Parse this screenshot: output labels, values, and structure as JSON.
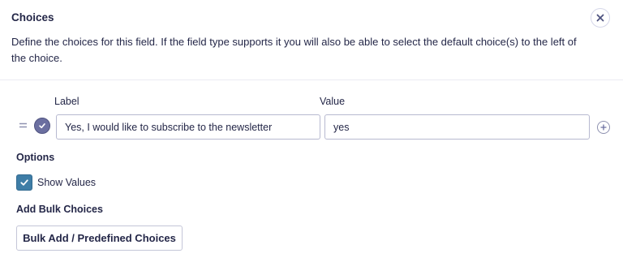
{
  "dialog": {
    "title": "Choices",
    "description": "Define the choices for this field. If the field type supports it you will also be able to select the default choice(s) to the left of the choice.",
    "close_icon": "close-icon"
  },
  "choices": {
    "label_header": "Label",
    "value_header": "Value",
    "rows": [
      {
        "label": "Yes, I would like to subscribe to the newsletter",
        "value": "yes",
        "is_default": true
      }
    ],
    "drag_icon": "drag-handle-icon",
    "add_icon": "plus-circle-icon"
  },
  "options": {
    "heading": "Options",
    "show_values_label": "Show Values",
    "show_values_checked": true
  },
  "bulk": {
    "heading": "Add Bulk Choices",
    "button_label": "Bulk Add / Predefined Choices"
  },
  "colors": {
    "text": "#242748",
    "checkbox_accent": "#3e7da6",
    "radio_selected": "#6b6fa0",
    "border": "#b7b9d0"
  }
}
